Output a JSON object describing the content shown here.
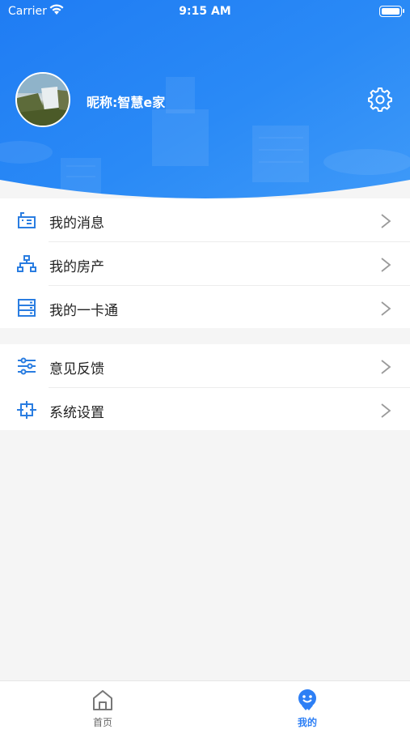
{
  "status_bar": {
    "carrier": "Carrier",
    "time": "9:15 AM"
  },
  "profile": {
    "nickname": "昵称:智慧e家"
  },
  "menu_group_1": [
    {
      "label": "我的消息",
      "icon": "message-icon"
    },
    {
      "label": "我的房产",
      "icon": "property-tree-icon"
    },
    {
      "label": "我的一卡通",
      "icon": "card-icon"
    }
  ],
  "menu_group_2": [
    {
      "label": "意见反馈",
      "icon": "feedback-sliders-icon"
    },
    {
      "label": "系统设置",
      "icon": "system-settings-icon"
    }
  ],
  "tabbar": {
    "home_label": "首页",
    "mine_label": "我的"
  },
  "colors": {
    "accent": "#2d7ff5",
    "header_gradient_start": "#1f7cf3",
    "header_gradient_end": "#3f9af8",
    "icon_blue": "#2a7de1"
  }
}
